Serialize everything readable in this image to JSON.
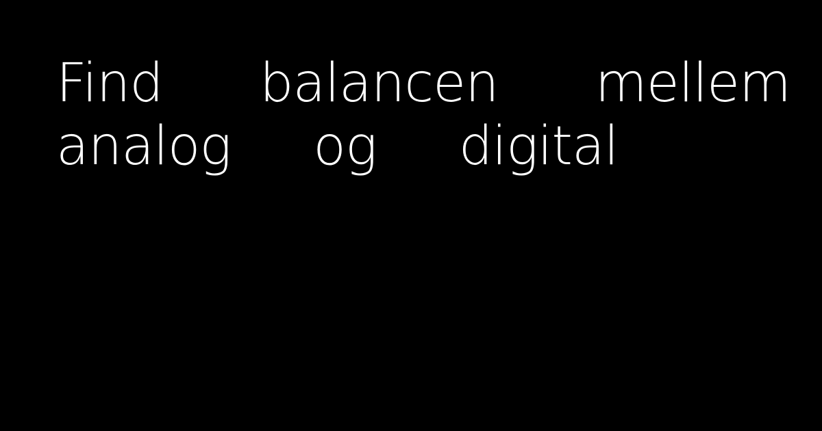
{
  "headline": {
    "line1": [
      "Find",
      "balancen",
      "mellem"
    ],
    "line2": [
      "analog",
      "og",
      "digital"
    ]
  },
  "colors": {
    "background": "#000000",
    "text": "#ffffff"
  }
}
